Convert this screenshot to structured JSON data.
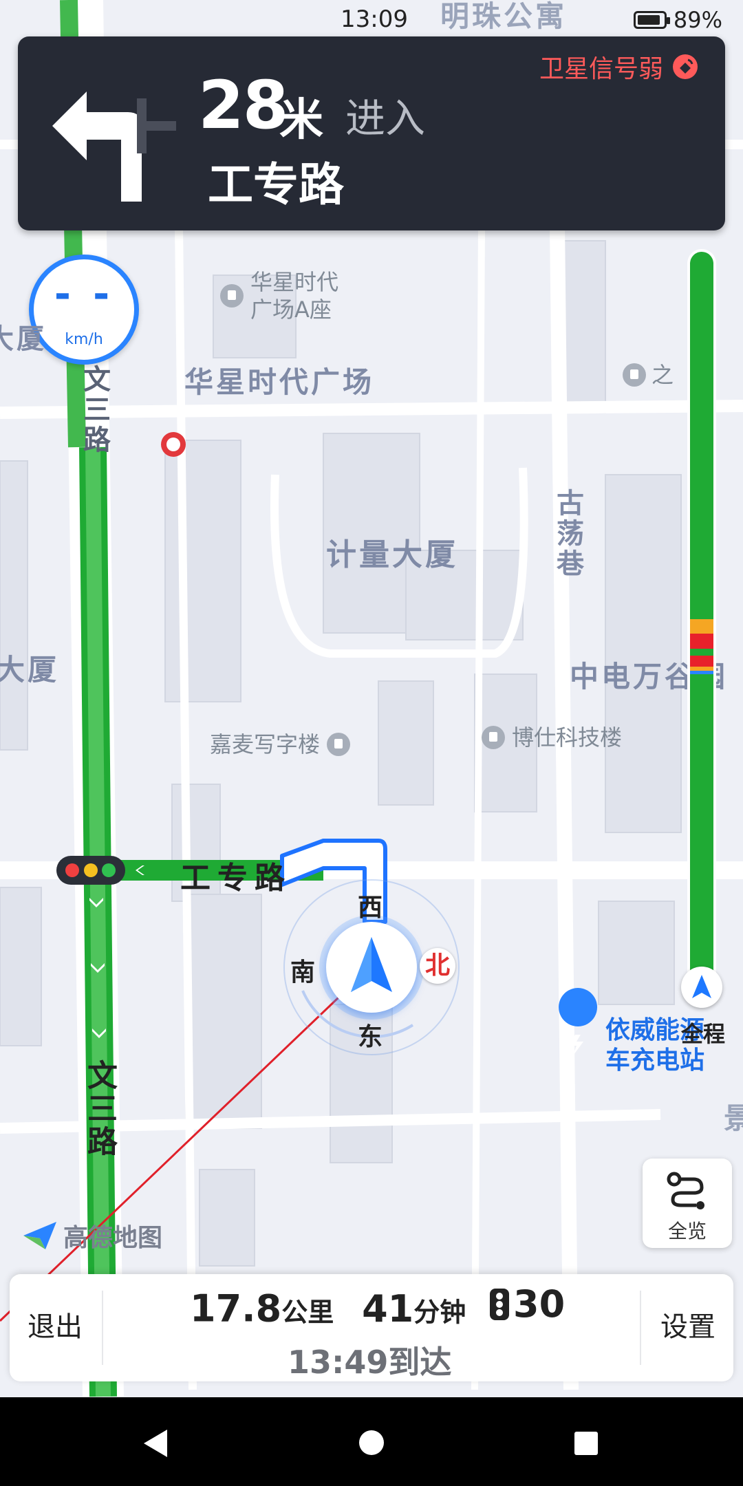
{
  "status": {
    "time": "13:09",
    "battery": "89%",
    "battery_level": 0.89
  },
  "guidance": {
    "distance": "28",
    "unit": "米",
    "action": "进入",
    "road": "工专路",
    "gps_warning": "卫星信号弱",
    "maneuver_icon": "turn-left-arrow-icon"
  },
  "speed": {
    "value": "- -",
    "unit": "km/h"
  },
  "map": {
    "top_label": "明珠公寓",
    "poi_huaxing_a": "华星时代\n广场A座",
    "huaxing_plaza": "华星时代广场",
    "zhi_label": "之",
    "wensan_road_upper": "文三路",
    "wensan_road_lower": "文三路",
    "jiliang": "计量大厦",
    "gudang_lane": "古荡巷",
    "dasha_left": "大厦",
    "da_left_top": "大厦",
    "zhongdian": "中电万谷园",
    "jiamai": "嘉麦写字楼",
    "boshi": "博仕科技楼",
    "gongzhuan_road": "工专路",
    "charging": "依威能源\n车充电站",
    "jing_right": "景",
    "brand": "高德地图"
  },
  "compass": {
    "north": "北",
    "south": "南",
    "east": "东",
    "west": "西"
  },
  "traffic_bar": {
    "full_route_label": "全程",
    "segments": [
      {
        "color": "#f5a623",
        "from": 0.5,
        "to": 0.52
      },
      {
        "color": "#e8212b",
        "from": 0.52,
        "to": 0.54
      },
      {
        "color": "#1faa34",
        "from": 0.54,
        "to": 0.55
      },
      {
        "color": "#e8212b",
        "from": 0.55,
        "to": 0.565
      },
      {
        "color": "#f5a623",
        "from": 0.565,
        "to": 0.57
      },
      {
        "color": "#2a84ff",
        "from": 0.57,
        "to": 0.575
      }
    ]
  },
  "overview_button": {
    "label": "全览"
  },
  "trip": {
    "distance": "17.8",
    "distance_unit": "公里",
    "duration": "41",
    "duration_unit": "分钟",
    "lights_count": "30",
    "eta": "13:49到达"
  },
  "bottom": {
    "exit": "退出",
    "settings": "设置"
  },
  "colors": {
    "route_green": "#1faa34",
    "accent_blue": "#2a84ff",
    "panel": "#262a35",
    "warning_red": "#ff5a5a"
  }
}
